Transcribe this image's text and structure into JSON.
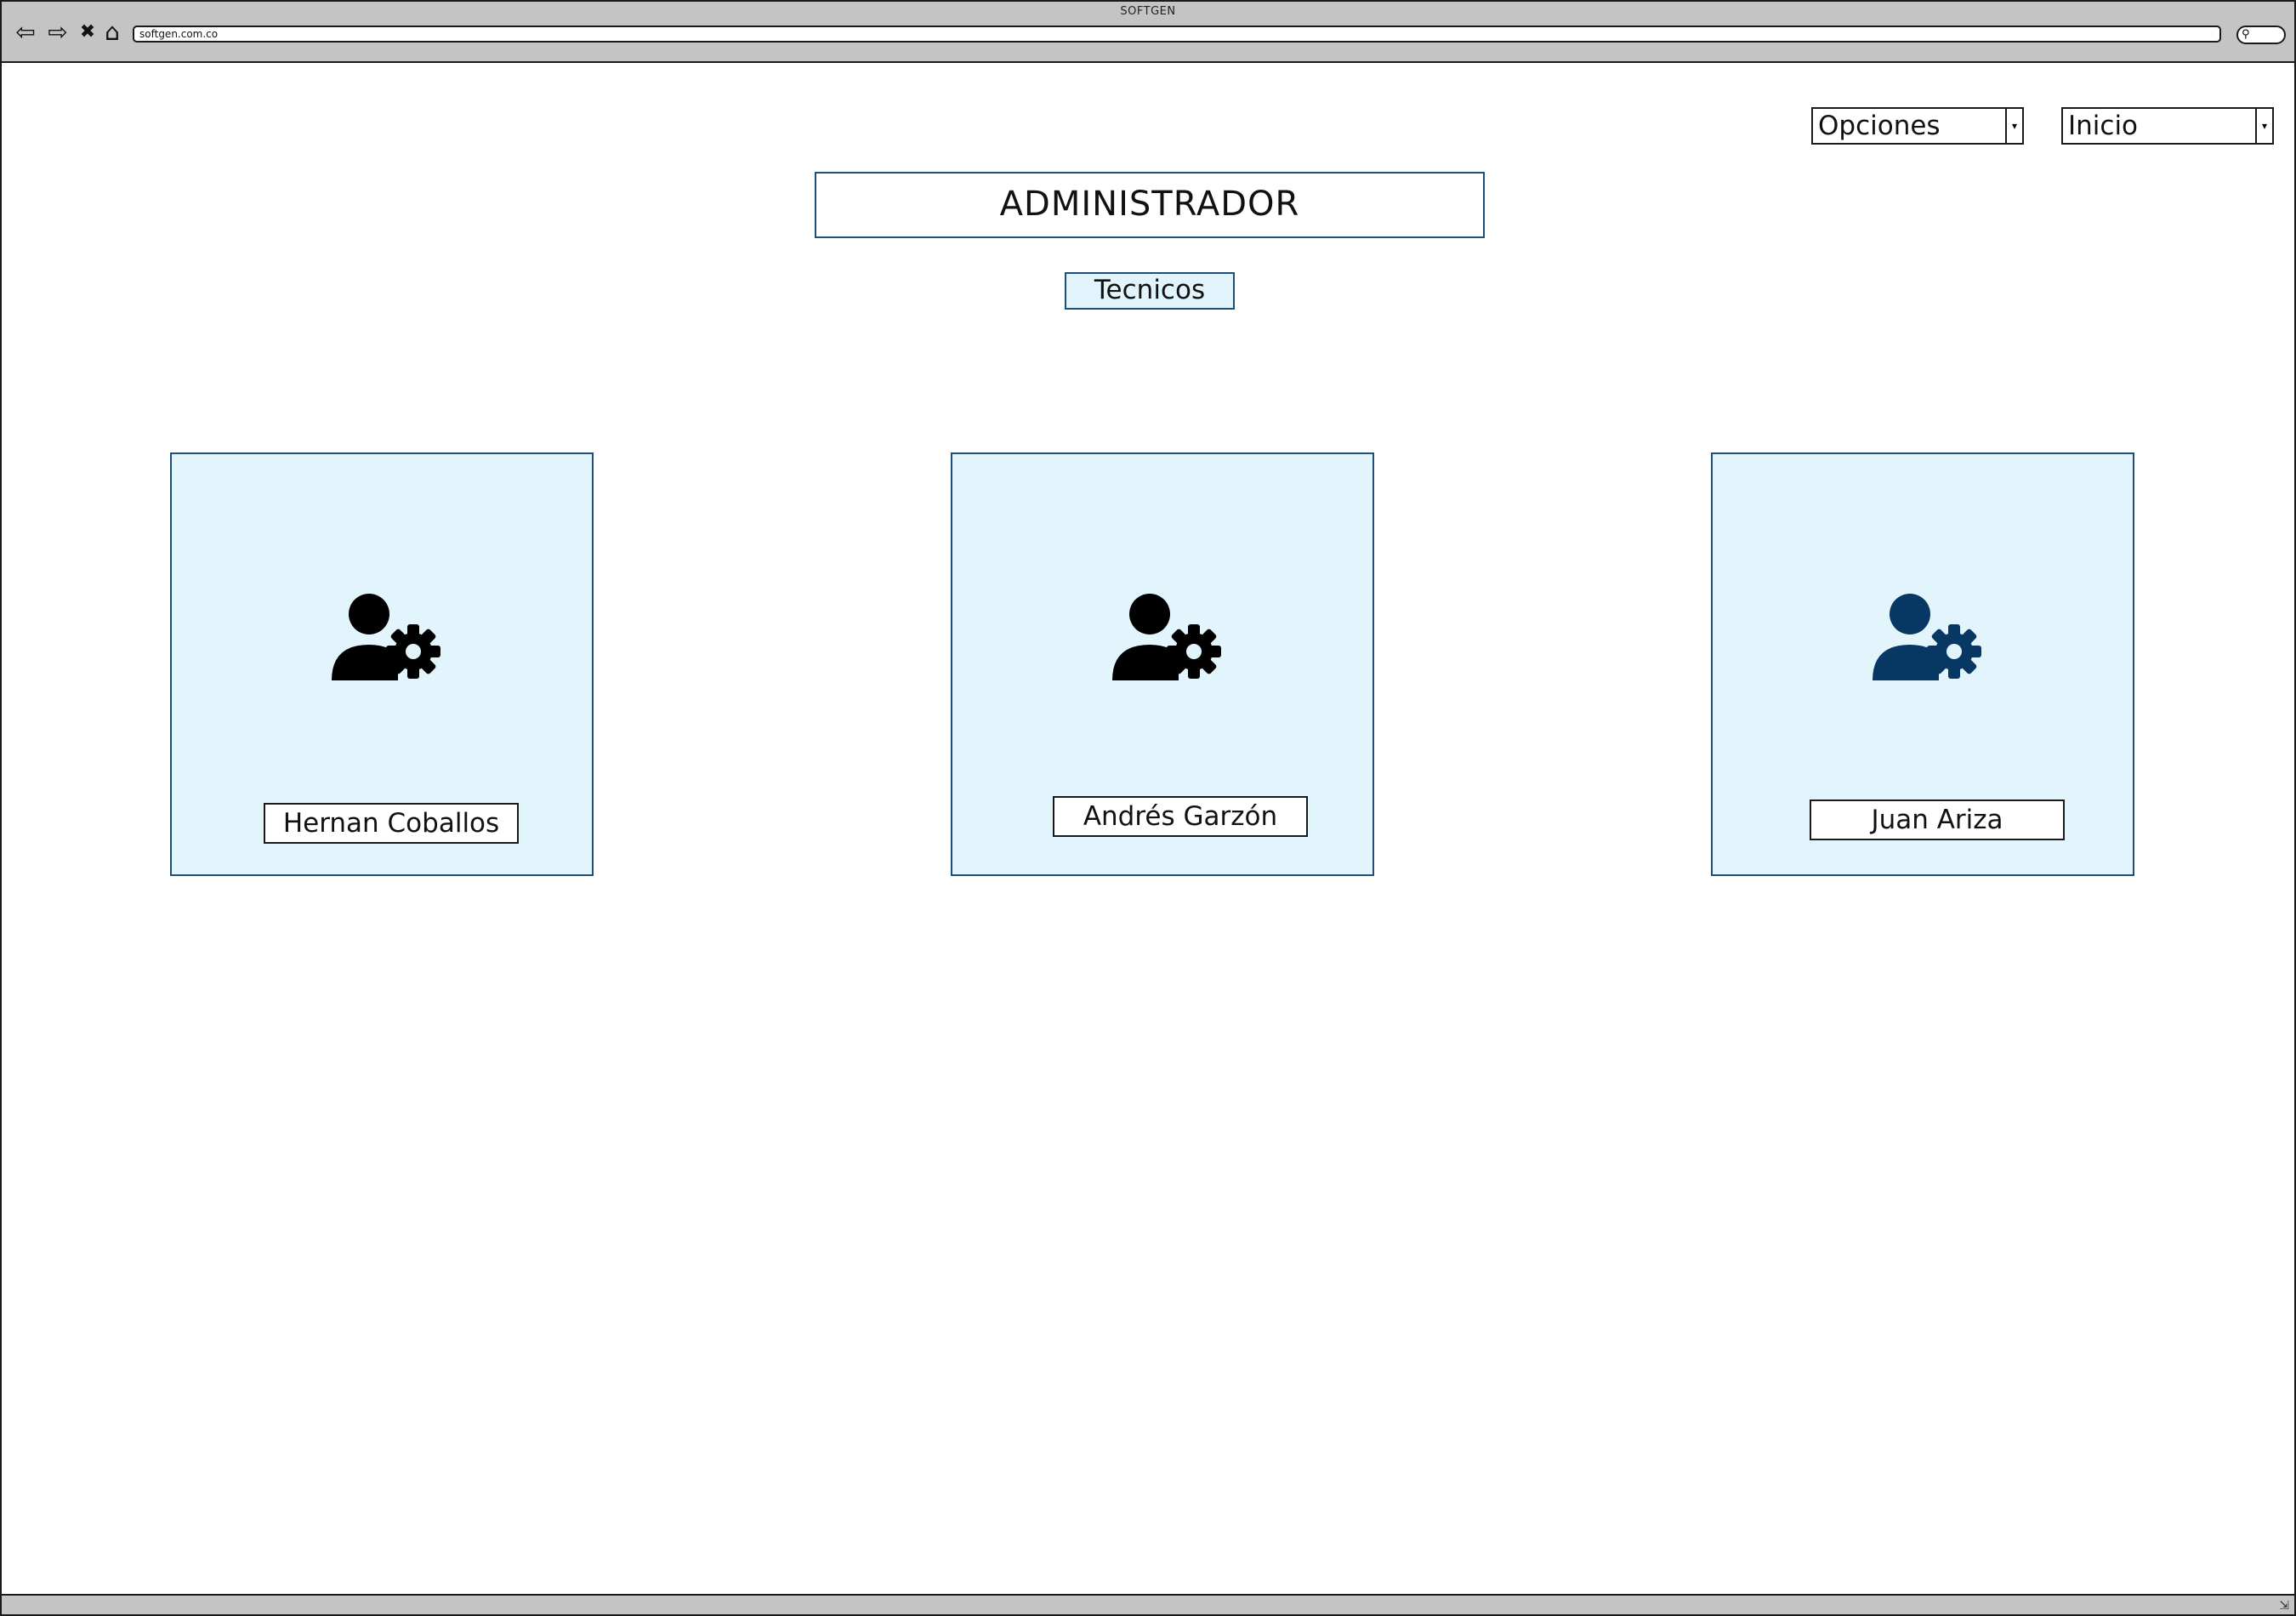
{
  "browser": {
    "title": "SOFTGEN",
    "url": "softgen.com.co",
    "nav": {
      "back": "⇦",
      "forward": "⇨",
      "stop": "✖",
      "home": "⌂"
    }
  },
  "header": {
    "options_select": {
      "value": "Opciones"
    },
    "home_select": {
      "value": "Inicio"
    }
  },
  "page": {
    "title": "ADMINISTRADOR",
    "tab_label": "Tecnicos"
  },
  "technicians": [
    {
      "name": "Hernan Coballos",
      "icon": "user-gear-icon",
      "color": "#000000"
    },
    {
      "name": "Andrés Garzón",
      "icon": "user-gear-icon",
      "color": "#000000"
    },
    {
      "name": "Juan Ariza",
      "icon": "user-gear-icon",
      "color": "#073763"
    }
  ],
  "colors": {
    "card_background": "#e3f5fc",
    "border_accent": "#1f4e79",
    "chrome": "#c4c4c4"
  }
}
